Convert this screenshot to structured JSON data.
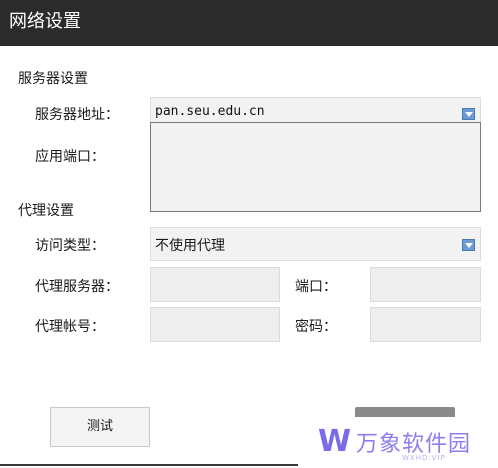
{
  "window": {
    "title": "网络设置"
  },
  "server_section": {
    "heading": "服务器设置",
    "address_label": "服务器地址：",
    "address_value": "pan.seu.edu.cn",
    "port_label": "应用端口："
  },
  "proxy_section": {
    "heading": "代理设置",
    "access_type_label": "访问类型：",
    "access_type_value": "不使用代理",
    "proxy_server_label": "代理服务器：",
    "port_label": "端口：",
    "account_label": "代理帐号：",
    "password_label": "密码："
  },
  "buttons": {
    "test_label": "测试"
  },
  "watermark": {
    "brand": "万象软件园",
    "site": "WXHD.VIP",
    "logo": "W"
  }
}
